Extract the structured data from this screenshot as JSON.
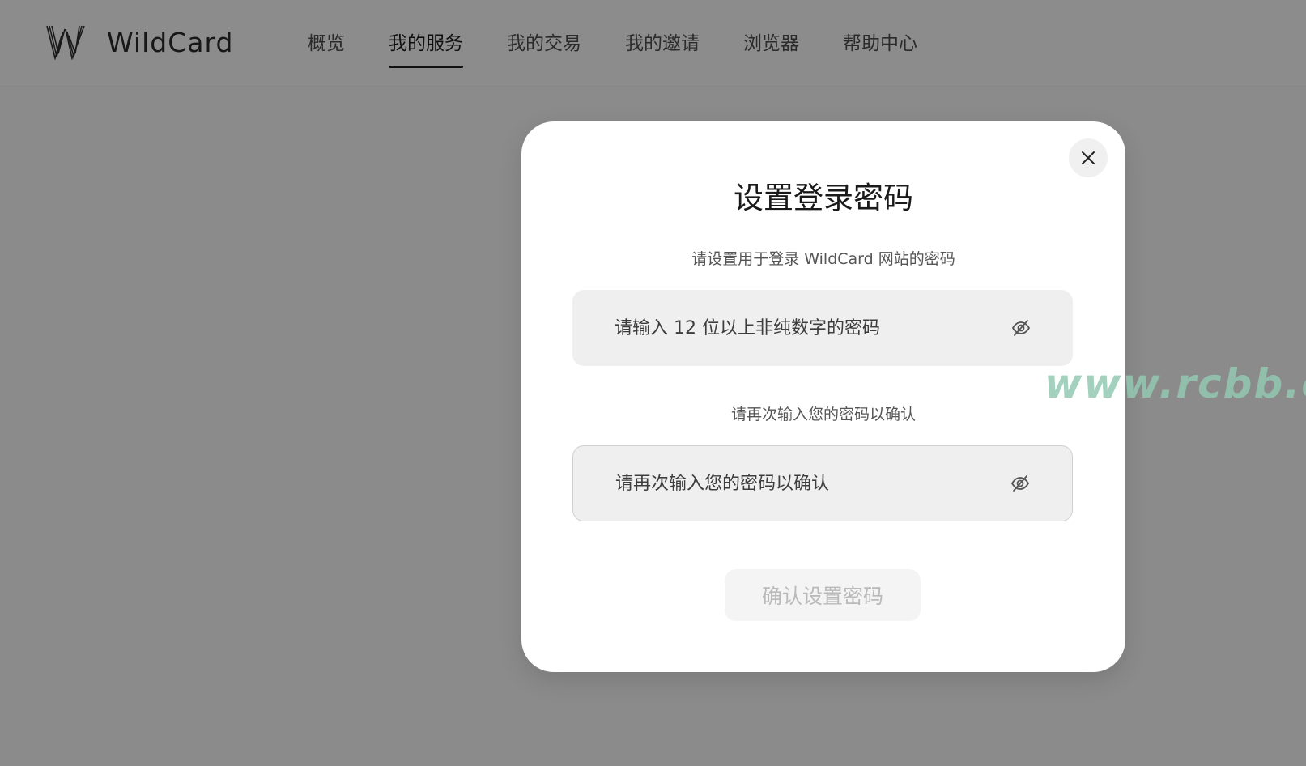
{
  "header": {
    "brand": "WildCard",
    "nav": [
      {
        "label": "概览"
      },
      {
        "label": "我的服务",
        "active": true
      },
      {
        "label": "我的交易"
      },
      {
        "label": "我的邀请"
      },
      {
        "label": "浏览器"
      },
      {
        "label": "帮助中心"
      }
    ]
  },
  "modal": {
    "title": "设置登录密码",
    "password_label": "请设置用于登录 WildCard 网站的密码",
    "password_placeholder": "请输入 12 位以上非纯数字的密码",
    "confirm_label": "请再次输入您的密码以确认",
    "confirm_placeholder": "请再次输入您的密码以确认",
    "submit_label": "确认设置密码",
    "close_icon": "close-icon",
    "toggle_icon": "eye-off-icon"
  },
  "watermark": "www.rcbb.cc",
  "colors": {
    "overlay": "#8b8b8b",
    "modal_bg": "#ffffff",
    "input_bg": "#efefef",
    "button_disabled_bg": "#f4f4f4",
    "button_disabled_text": "#b9b9b9"
  }
}
